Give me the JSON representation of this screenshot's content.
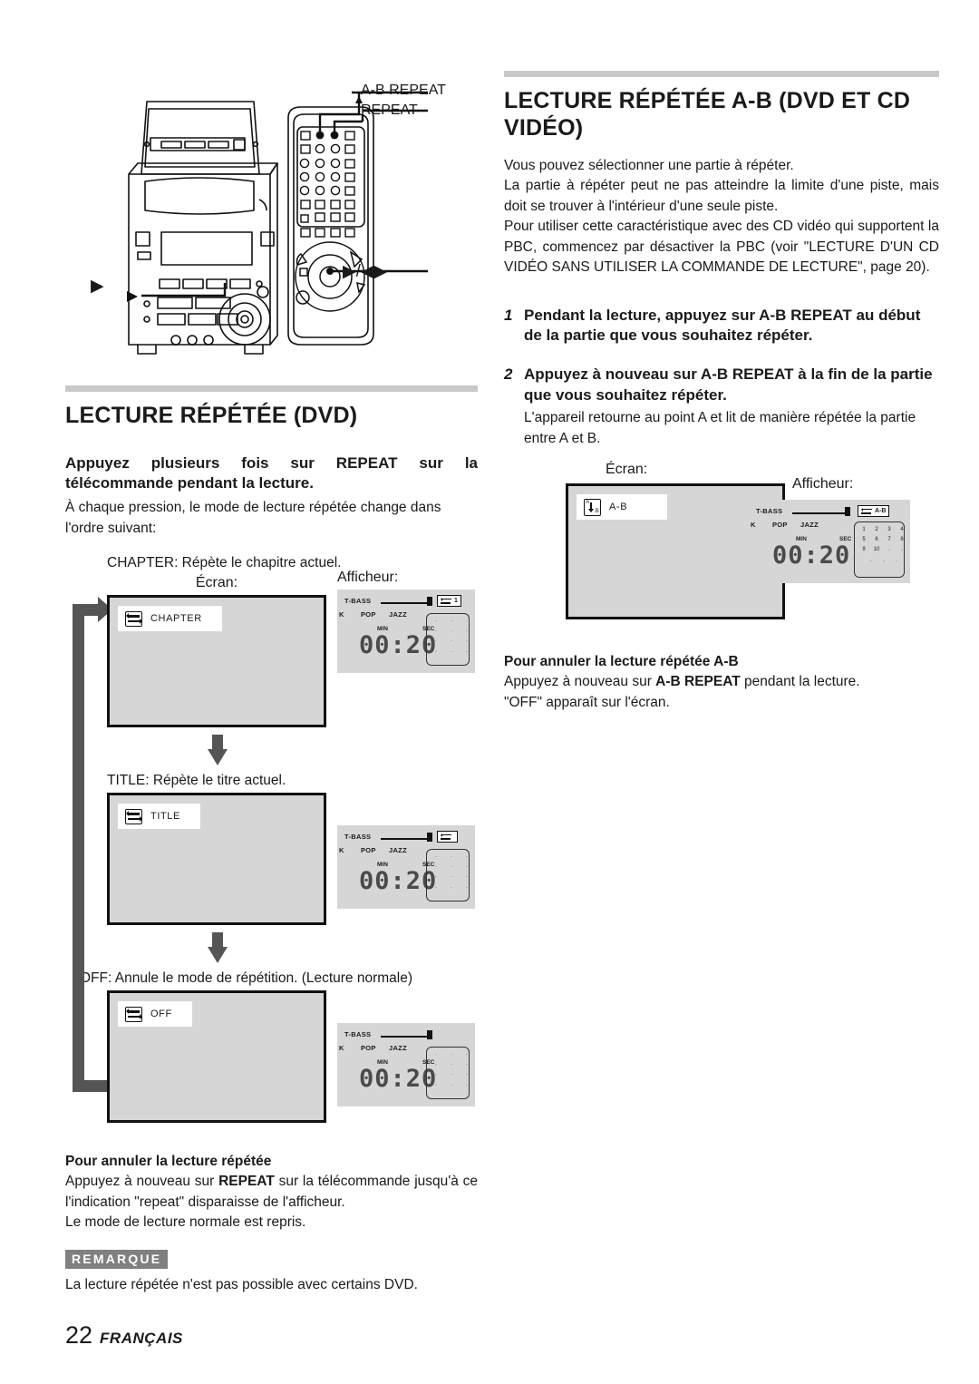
{
  "illustration": {
    "callouts": [
      {
        "id": "ab-repeat",
        "label": "A-B REPEAT"
      },
      {
        "id": "repeat",
        "label": "REPEAT"
      },
      {
        "id": "cursor",
        "label": "▶/◀▶"
      }
    ]
  },
  "left_column": {
    "section_title": "LECTURE RÉPÉTÉE (DVD)",
    "lead": "Appuyez plusieurs fois sur REPEAT sur la télécommande pendant la lecture.",
    "intro": "À chaque pression, le mode de lecture répétée change dans l'ordre suivant:",
    "screen_caption": "Écran:",
    "display_caption": "Afficheur:",
    "steps": [
      {
        "caption": "CHAPTER: Répète le chapitre actuel.",
        "osd_icon": "repeat-icon",
        "osd_label": "CHAPTER",
        "display": {
          "tbass": "T-BASS",
          "eq": [
            "K",
            "POP",
            "JAZZ"
          ],
          "badge_icon": "repeat-icon",
          "badge_text": "1",
          "min_label": "MIN",
          "sec_label": "SEC",
          "time": "00:20",
          "track_rows": [
            [
              ".",
              ".",
              "."
            ],
            [
              ".",
              ".",
              "."
            ],
            [
              ".",
              ".",
              "."
            ],
            [
              ".",
              ".",
              "."
            ]
          ]
        }
      },
      {
        "caption": "TITLE: Répète le titre actuel.",
        "osd_icon": "repeat-icon",
        "osd_label": "TITLE",
        "display": {
          "tbass": "T-BASS",
          "eq": [
            "K",
            "POP",
            "JAZZ"
          ],
          "badge_icon": "repeat-icon",
          "badge_text": "",
          "min_label": "MIN",
          "sec_label": "SEC",
          "time": "00:20",
          "track_rows": [
            [
              ".",
              ".",
              "."
            ],
            [
              ".",
              ".",
              "."
            ],
            [
              ".",
              ".",
              "."
            ],
            [
              ".",
              ".",
              "."
            ]
          ]
        }
      },
      {
        "caption": "OFF: Annule le mode de répétition. (Lecture normale)",
        "osd_icon": "repeat-icon",
        "osd_label": "OFF",
        "display": {
          "tbass": "T-BASS",
          "eq": [
            "K",
            "POP",
            "JAZZ"
          ],
          "badge_icon": "",
          "badge_text": "",
          "min_label": "MIN",
          "sec_label": "SEC",
          "time": "00:20",
          "track_rows": [
            [
              ".",
              ".",
              "."
            ],
            [
              ".",
              ".",
              "."
            ],
            [
              ".",
              ".",
              "."
            ],
            [
              ".",
              ".",
              "."
            ]
          ]
        }
      }
    ],
    "cancel_heading": "Pour annuler la lecture répétée",
    "cancel_text_1": "Appuyez à nouveau sur ",
    "cancel_bold": "REPEAT",
    "cancel_text_2": " sur la télécommande jusqu'à ce l'indication \"repeat\" disparaisse de l'afficheur.",
    "cancel_text_3": "Le mode de lecture normale est repris.",
    "note_badge": "REMARQUE",
    "note_text": "La lecture répétée n'est pas possible avec certains DVD."
  },
  "right_column": {
    "section_title": "LECTURE RÉPÉTÉE A-B (DVD ET CD VIDÉO)",
    "intro_1": "Vous pouvez sélectionner une partie à répéter.",
    "intro_2": "La partie à répéter peut ne pas atteindre la limite d'une piste, mais doit se trouver à l'intérieur d'une seule piste.",
    "intro_3": "Pour utiliser cette caractéristique avec des CD vidéo qui supportent la PBC, commencez par désactiver la PBC (voir \"LECTURE D'UN CD VIDÉO SANS UTILISER LA COMMANDE DE LECTURE\", page 20).",
    "steps": [
      {
        "num": "1",
        "title": "Pendant la lecture, appuyez sur A-B REPEAT au début de la partie que vous souhaitez répéter.",
        "desc": ""
      },
      {
        "num": "2",
        "title": "Appuyez à nouveau sur A-B REPEAT à la fin de la partie que vous souhaitez répéter.",
        "desc": "L'appareil retourne au point A et lit de manière répétée la partie entre A et B."
      }
    ],
    "screen_caption": "Écran:",
    "display_caption": "Afficheur:",
    "osd_icon": "ab-repeat-icon",
    "osd_label": "A-B",
    "display": {
      "tbass": "T-BASS",
      "eq": [
        "K",
        "POP",
        "JAZZ"
      ],
      "badge_icon": "repeat-icon",
      "badge_text": "A-B",
      "min_label": "MIN",
      "sec_label": "SEC",
      "time": "00:20",
      "track_rows": [
        [
          "1",
          "2",
          "3",
          "4"
        ],
        [
          "5",
          "6",
          "7",
          "8"
        ],
        [
          "9",
          "10",
          ".",
          "."
        ],
        [
          ".",
          ".",
          "."
        ]
      ]
    },
    "cancel_heading": "Pour annuler la lecture répétée A-B",
    "cancel_text_1": "Appuyez à nouveau sur ",
    "cancel_bold": "A-B REPEAT",
    "cancel_text_2": " pendant la lecture.",
    "cancel_text_3": "\"OFF\" apparaît sur l'écran."
  },
  "footer": {
    "page_number": "22",
    "language": "FRANÇAIS"
  },
  "colors": {
    "rule": "#c9c9c9",
    "screen_fill": "#d6d6d6",
    "arrow": "#555555",
    "note_badge_bg": "#808080"
  }
}
